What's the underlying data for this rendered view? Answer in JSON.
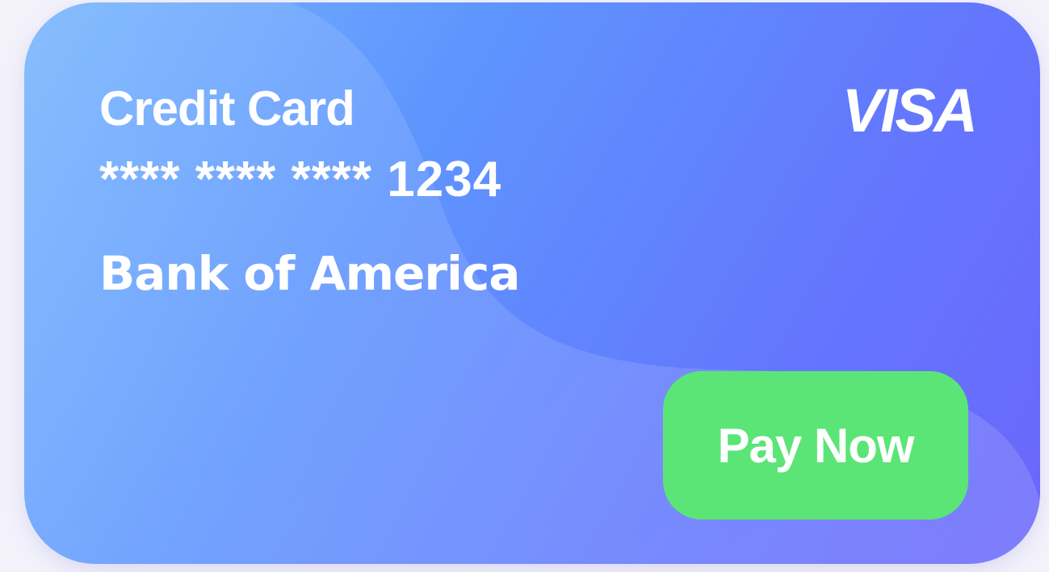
{
  "card": {
    "title": "Credit Card",
    "masked_number": "**** **** **** 1234",
    "bank_name": "Bank of America",
    "brand": "VISA",
    "pay_button_label": "Pay Now"
  },
  "colors": {
    "page_background": "#f3f2fb",
    "card_gradient_start": "#78b7fd",
    "card_gradient_mid": "#5e95fe",
    "card_gradient_end": "#6a66fc",
    "pay_button": "#5be577",
    "text": "#ffffff"
  },
  "icons": {
    "brand_logo": "visa-logo"
  }
}
